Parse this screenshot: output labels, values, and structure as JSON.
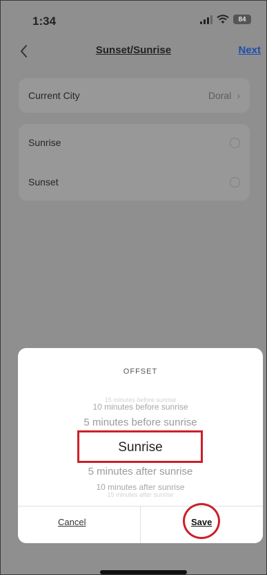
{
  "status_bar": {
    "time": "1:34",
    "battery": "84"
  },
  "nav": {
    "title": "Sunset/Sunrise",
    "next_label": "Next"
  },
  "city_card": {
    "label": "Current City",
    "value": "Doral"
  },
  "options": [
    {
      "label": "Sunrise"
    },
    {
      "label": "Sunset"
    }
  ],
  "sheet": {
    "title": "OFFSET",
    "picker": [
      "15 minutes before sunrise",
      "10 minutes before sunrise",
      "5 minutes before sunrise",
      "Sunrise",
      "5 minutes after sunrise",
      "10 minutes after sunrise",
      "15 minutes after sunrise"
    ],
    "selected": "Sunrise",
    "cancel_label": "Cancel",
    "save_label": "Save"
  },
  "colors": {
    "accent": "#1a4fb0",
    "annotation": "#cc1f2a",
    "overlay": "#8f8f8f"
  }
}
